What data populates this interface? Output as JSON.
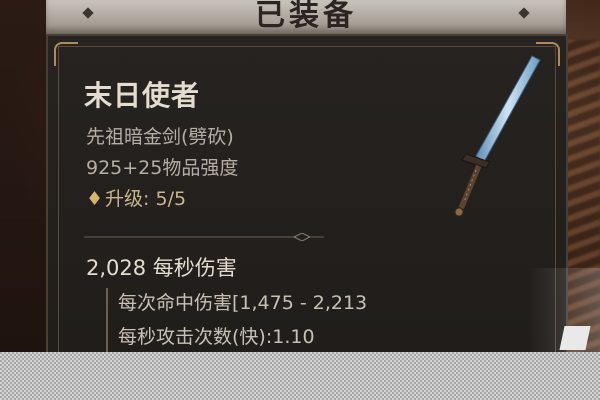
{
  "header": {
    "title": "已装备"
  },
  "item": {
    "name": "末日使者",
    "type": "先祖暗金剑(劈砍)",
    "item_power": "925+25物品强度",
    "upgrade_icon": "diamond-upgrade-icon",
    "upgrade_label": "升级: 5/5"
  },
  "stats": {
    "dps": "2,028 每秒伤害",
    "damage_per_hit": "每次命中伤害[1,475 - 2,213",
    "attack_speed": "每秒攻击次数(快):1.10"
  },
  "colors": {
    "panel_bg": "#231f1c",
    "frame_gold": "#b08a5e",
    "header_bg": "#b9b3aa",
    "text_primary": "#e4dccf",
    "text_secondary": "#b6aea2",
    "upgrade_gold": "#d7b56a",
    "sword_blade": "#8fb7d8"
  }
}
